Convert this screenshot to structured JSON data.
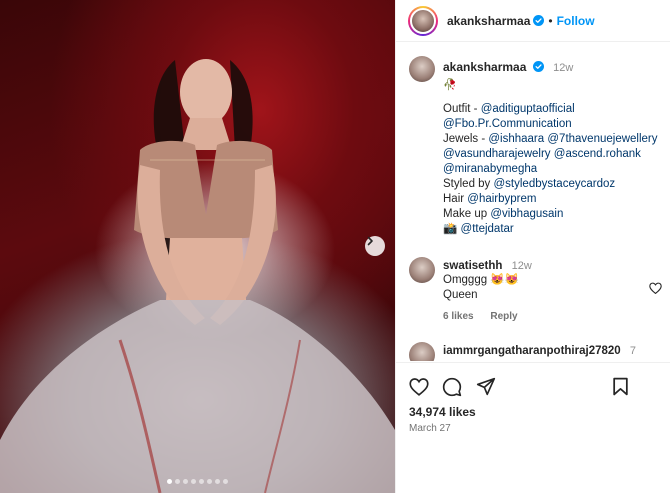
{
  "post": {
    "carousel_dots_total": 8,
    "carousel_dot_active": 0
  },
  "header": {
    "username": "akanksharmaa",
    "separator": "•",
    "follow_label": "Follow"
  },
  "caption": {
    "username": "akanksharmaa",
    "time": "12w",
    "emoji": "🥀",
    "lines": [
      [
        {
          "t": "Outfit - "
        },
        {
          "t": "@aditiguptaofficial",
          "m": true
        }
      ],
      [
        {
          "t": "@Fbo.Pr.Communication",
          "m": true
        }
      ],
      [
        {
          "t": "Jewels - "
        },
        {
          "t": "@ishhaara",
          "m": true
        },
        {
          "t": " "
        },
        {
          "t": "@7thavenuejewellery",
          "m": true
        }
      ],
      [
        {
          "t": "@vasundharajewelry",
          "m": true
        },
        {
          "t": " "
        },
        {
          "t": "@ascend.rohank",
          "m": true
        }
      ],
      [
        {
          "t": "@miranabymegha",
          "m": true
        }
      ],
      [
        {
          "t": "Styled by "
        },
        {
          "t": "@styledbystaceycardoz",
          "m": true
        }
      ],
      [
        {
          "t": "Hair "
        },
        {
          "t": "@hairbyprem",
          "m": true
        }
      ],
      [
        {
          "t": "Make up "
        },
        {
          "t": "@vibhagusain",
          "m": true
        }
      ],
      [
        {
          "t": "📸 "
        },
        {
          "t": "@ttejdatar",
          "m": true
        }
      ]
    ]
  },
  "comments": [
    {
      "username": "swatisethh",
      "time": "12w",
      "lines": [
        "Omgggg 😻😻",
        "Queen"
      ],
      "likes": "6 likes",
      "reply": "Reply"
    },
    {
      "username": "iammrgangatharanpothiraj27820",
      "time": "7"
    }
  ],
  "actions": {
    "likes": "34,974 likes",
    "date": "March 27"
  }
}
